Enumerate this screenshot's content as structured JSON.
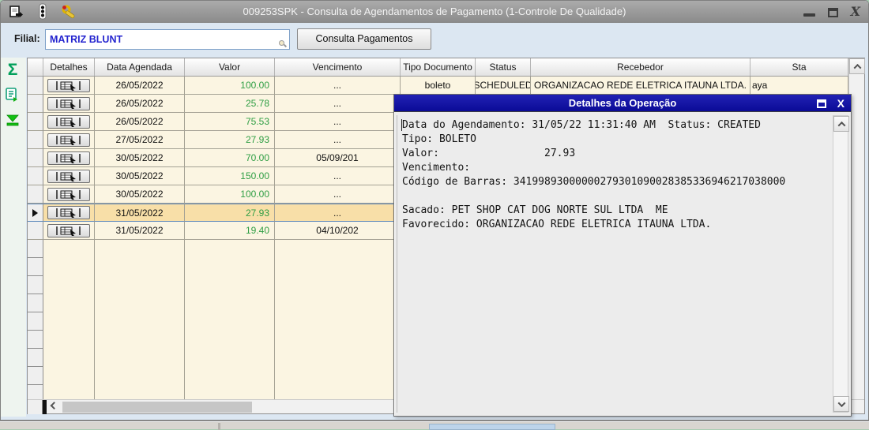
{
  "window": {
    "title": "009253SPK - Consulta de Agendamentos de Pagamento (1-Controle De Qualidade)",
    "close_glyph": "X"
  },
  "filial": {
    "label": "Filial:",
    "value": "MATRIZ BLUNT",
    "button_label": "Consulta Pagamentos"
  },
  "side_icons": {
    "sigma_glyph": "Σ"
  },
  "table": {
    "headers": [
      "",
      "Detalhes",
      "Data Agendada",
      "Valor",
      "Vencimento",
      "Tipo Documento",
      "Status",
      "Recebedor",
      "Sta"
    ],
    "rows": [
      {
        "data": "26/05/2022",
        "valor": "100.00",
        "vencimento": "...",
        "tipo": "boleto",
        "status": "SCHEDULED",
        "recebedor": "ORGANIZACAO REDE ELETRICA ITAUNA LTDA.",
        "sta": "aya",
        "selected": false
      },
      {
        "data": "26/05/2022",
        "valor": "25.78",
        "vencimento": "...",
        "tipo": "",
        "status": "",
        "recebedor": "",
        "sta": "",
        "selected": false
      },
      {
        "data": "26/05/2022",
        "valor": "75.53",
        "vencimento": "...",
        "tipo": "",
        "status": "",
        "recebedor": "",
        "sta": "",
        "selected": false
      },
      {
        "data": "27/05/2022",
        "valor": "27.93",
        "vencimento": "...",
        "tipo": "",
        "status": "",
        "recebedor": "",
        "sta": "",
        "selected": false
      },
      {
        "data": "30/05/2022",
        "valor": "70.00",
        "vencimento": "05/09/201",
        "tipo": "",
        "status": "",
        "recebedor": "",
        "sta": "",
        "selected": false
      },
      {
        "data": "30/05/2022",
        "valor": "150.00",
        "vencimento": "...",
        "tipo": "",
        "status": "",
        "recebedor": "",
        "sta": "",
        "selected": false
      },
      {
        "data": "30/05/2022",
        "valor": "100.00",
        "vencimento": "...",
        "tipo": "",
        "status": "",
        "recebedor": "",
        "sta": "",
        "selected": false
      },
      {
        "data": "31/05/2022",
        "valor": "27.93",
        "vencimento": "...",
        "tipo": "",
        "status": "",
        "recebedor": "",
        "sta": "",
        "selected": true
      },
      {
        "data": "31/05/2022",
        "valor": "19.40",
        "vencimento": "04/10/202",
        "tipo": "",
        "status": "",
        "recebedor": "",
        "sta": "",
        "selected": false
      }
    ]
  },
  "popup": {
    "title": "Detalhes da Operação",
    "close_glyph": "X",
    "lines": [
      "Data do Agendamento: 31/05/22 11:31:40 AM  Status: CREATED",
      "Tipo: BOLETO",
      "Valor:                 27.93",
      "Vencimento:",
      "Código de Barras: 34199893000000279301090028385336946217038000",
      "",
      "Sacado: PET SHOP CAT DOG NORTE SUL LTDA  ME",
      "Favorecido: ORGANIZACAO REDE ELETRICA ITAUNA LTDA."
    ]
  },
  "colors": {
    "popup_titlebar": "#0a0a96",
    "value_green": "#2f9e44",
    "selected_row": "#f8dfa8",
    "cell_cream": "#fbf5e2",
    "input_text_blue": "#2525cf"
  }
}
